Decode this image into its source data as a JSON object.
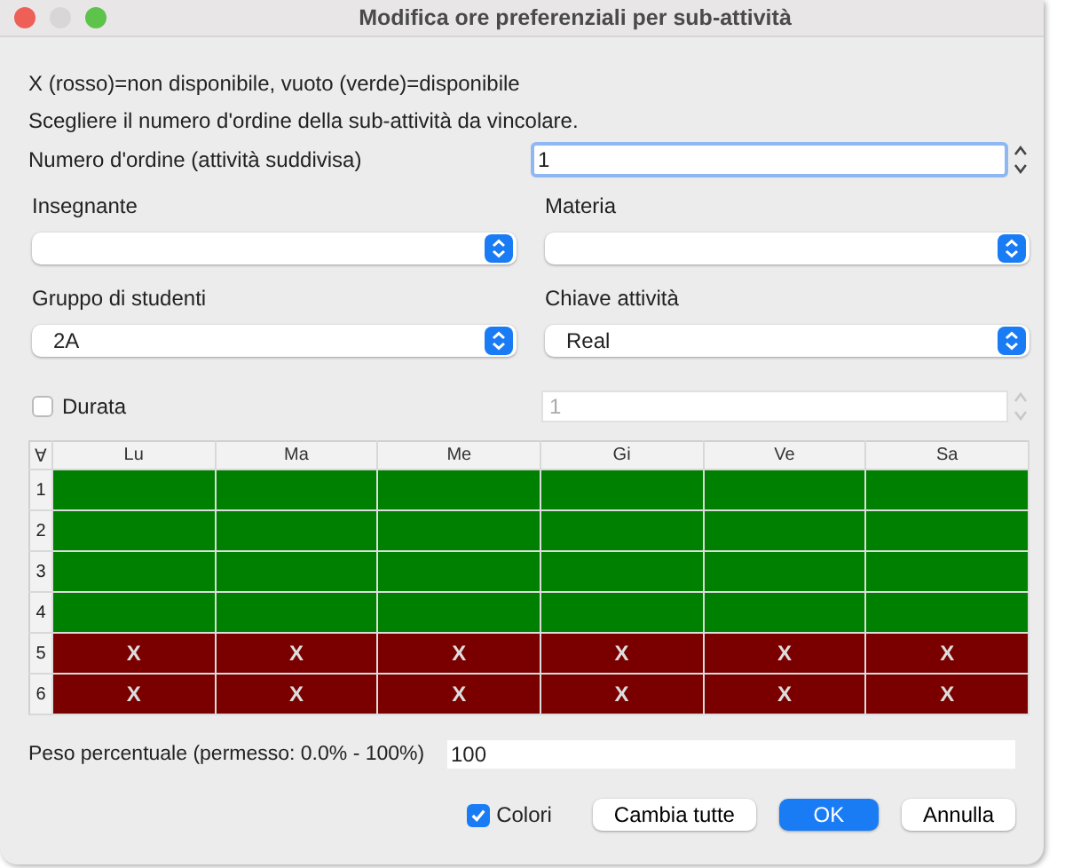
{
  "window": {
    "title": "Modifica ore preferenziali per sub-attività"
  },
  "legend": "X (rosso)=non disponibile, vuoto (verde)=disponibile",
  "instruction": "Scegliere il numero d'ordine della sub-attività da vincolare.",
  "order_number": {
    "label": "Numero d'ordine (attività suddivisa)",
    "value": "1"
  },
  "filters": [
    {
      "label": "Insegnante"
    },
    {
      "label": "Materia"
    },
    {
      "label": "Gruppo di studenti",
      "value": "2A"
    },
    {
      "label": "Chiave attività",
      "value": "Real"
    }
  ],
  "duration": {
    "label": "Durata",
    "checked": false,
    "value": "1",
    "disabled": true
  },
  "grid": {
    "corner": "∀",
    "columns": [
      "Lu",
      "Ma",
      "Me",
      "Gi",
      "Ve",
      "Sa"
    ],
    "rows": [
      {
        "label": "1",
        "cells": [
          {
            "unavailable": false
          },
          {
            "unavailable": false
          },
          {
            "unavailable": false
          },
          {
            "unavailable": false
          },
          {
            "unavailable": false
          },
          {
            "unavailable": false
          }
        ]
      },
      {
        "label": "2",
        "cells": [
          {
            "unavailable": false
          },
          {
            "unavailable": false
          },
          {
            "unavailable": false
          },
          {
            "unavailable": false
          },
          {
            "unavailable": false
          },
          {
            "unavailable": false
          }
        ]
      },
      {
        "label": "3",
        "cells": [
          {
            "unavailable": false
          },
          {
            "unavailable": false
          },
          {
            "unavailable": false
          },
          {
            "unavailable": false
          },
          {
            "unavailable": false
          },
          {
            "unavailable": false
          }
        ]
      },
      {
        "label": "4",
        "cells": [
          {
            "unavailable": false
          },
          {
            "unavailable": false
          },
          {
            "unavailable": false
          },
          {
            "unavailable": false
          },
          {
            "unavailable": false
          },
          {
            "unavailable": false
          }
        ]
      },
      {
        "label": "5",
        "cells": [
          {
            "unavailable": true,
            "text": "X"
          },
          {
            "unavailable": true,
            "text": "X"
          },
          {
            "unavailable": true,
            "text": "X"
          },
          {
            "unavailable": true,
            "text": "X"
          },
          {
            "unavailable": true,
            "text": "X"
          },
          {
            "unavailable": true,
            "text": "X"
          }
        ]
      },
      {
        "label": "6",
        "cells": [
          {
            "unavailable": true,
            "text": "X"
          },
          {
            "unavailable": true,
            "text": "X"
          },
          {
            "unavailable": true,
            "text": "X"
          },
          {
            "unavailable": true,
            "text": "X"
          },
          {
            "unavailable": true,
            "text": "X"
          },
          {
            "unavailable": true,
            "text": "X"
          }
        ]
      }
    ]
  },
  "weight": {
    "label": "Peso percentuale (permesso: 0.0% - 100%)",
    "value": "100"
  },
  "colors": {
    "label": "Colori",
    "checked": true
  },
  "buttons": [
    {
      "label": "Cambia tutte",
      "kind": "normal"
    },
    {
      "label": "OK",
      "kind": "default"
    },
    {
      "label": "Annulla",
      "kind": "normal"
    }
  ]
}
